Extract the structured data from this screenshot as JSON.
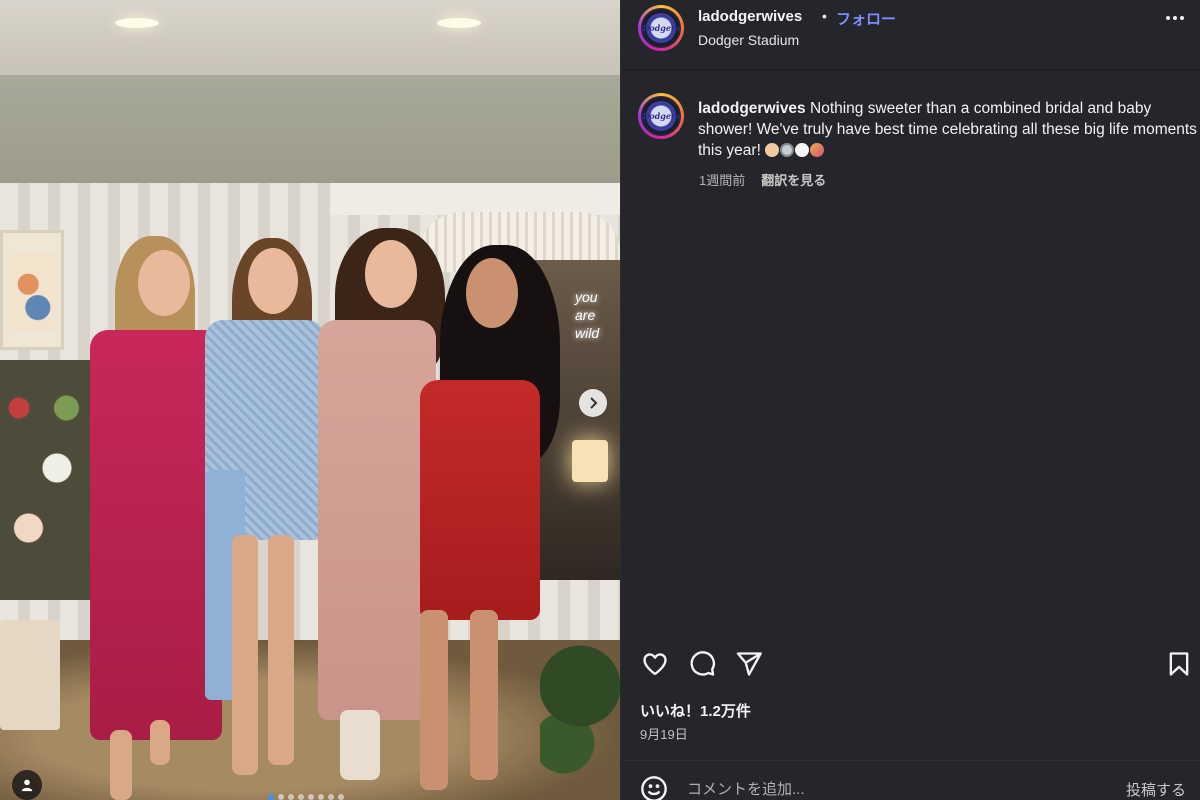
{
  "post": {
    "username": "ladodgerwives",
    "separator": "•",
    "follow_label": "フォロー",
    "location": "Dodger Stadium",
    "more_icon": "more-horizontal-icon",
    "avatar_text": "Dodgers"
  },
  "photo": {
    "neon_sign": "you\nare\nwild",
    "carousel_count": 8,
    "carousel_active_index": 0
  },
  "caption": {
    "username": "ladodgerwives",
    "text": "Nothing sweeter than a combined bridal and baby shower! We've truly have best time celebrating all these big life moments this year!",
    "emojis": [
      "baby-face-emoji",
      "ring-emoji",
      "white-heart-emoji",
      "party-popper-emoji"
    ],
    "time_ago": "1週間前",
    "translate_label": "翻訳を見る"
  },
  "actions": {
    "like_icon": "heart-icon",
    "comment_icon": "comment-icon",
    "share_icon": "send-icon",
    "save_icon": "bookmark-icon"
  },
  "likes": "いいね！1.2万件",
  "date": "9月19日",
  "comment": {
    "placeholder": "コメントを追加...",
    "post_label": "投稿する",
    "emoji_icon": "smile-icon"
  },
  "colors": {
    "panel_bg": "#25262b",
    "follow_link": "#7f8cff",
    "text": "#f5f5f5"
  }
}
